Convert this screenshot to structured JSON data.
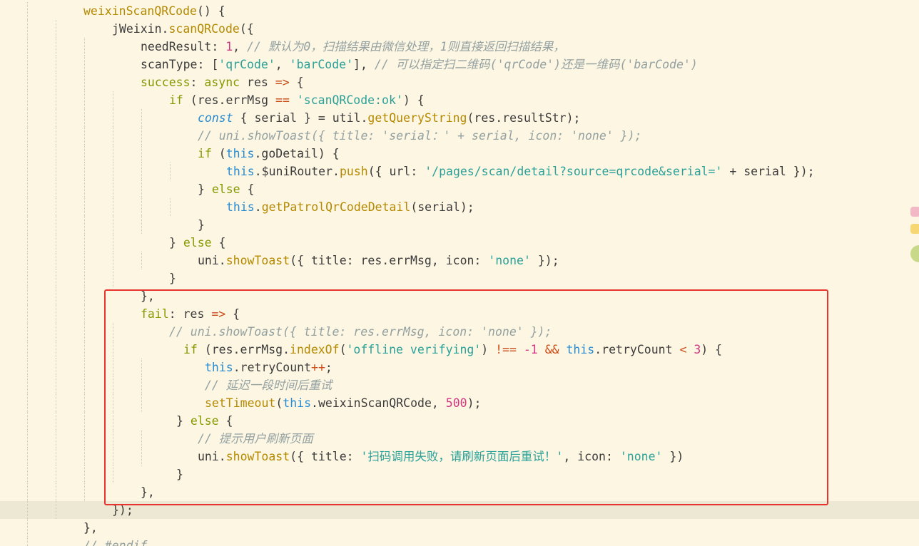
{
  "editor": {
    "language": "javascript",
    "current_line_index": 28,
    "lines": [
      {
        "indent": 0,
        "tokens": [
          [
            "fn",
            "weixinScanQRCode"
          ],
          [
            "plain",
            "() {"
          ]
        ]
      },
      {
        "indent": 1,
        "tokens": [
          [
            "plain",
            "jWeixin."
          ],
          [
            "fn",
            "scanQRCode"
          ],
          [
            "plain",
            "({"
          ]
        ]
      },
      {
        "indent": 2,
        "tokens": [
          [
            "plain",
            "needResult: "
          ],
          [
            "num",
            "1"
          ],
          [
            "plain",
            ", "
          ],
          [
            "cm",
            "// 默认为0，扫描结果由微信处理，1则直接返回扫描结果，"
          ]
        ]
      },
      {
        "indent": 2,
        "tokens": [
          [
            "plain",
            "scanType: ["
          ],
          [
            "str",
            "'qrCode'"
          ],
          [
            "plain",
            ", "
          ],
          [
            "str",
            "'barCode'"
          ],
          [
            "plain",
            "], "
          ],
          [
            "cm",
            "// 可以指定扫二维码('qrCode')还是一维码('barCode')"
          ]
        ]
      },
      {
        "indent": 2,
        "tokens": [
          [
            "prop",
            "success"
          ],
          [
            "plain",
            ": "
          ],
          [
            "kw",
            "async"
          ],
          [
            "plain",
            " res "
          ],
          [
            "op",
            "=>"
          ],
          [
            "plain",
            " {"
          ]
        ]
      },
      {
        "indent": 3,
        "tokens": [
          [
            "kw",
            "if"
          ],
          [
            "plain",
            " (res.errMsg "
          ],
          [
            "op",
            "=="
          ],
          [
            "plain",
            " "
          ],
          [
            "str",
            "'scanQRCode:ok'"
          ],
          [
            "plain",
            ") {"
          ]
        ]
      },
      {
        "indent": 4,
        "tokens": [
          [
            "const",
            "const"
          ],
          [
            "plain",
            " { serial } = util."
          ],
          [
            "fn",
            "getQueryString"
          ],
          [
            "plain",
            "(res.resultStr);"
          ]
        ]
      },
      {
        "indent": 4,
        "tokens": [
          [
            "cm",
            "// uni.showToast({ title: 'serial：' + serial, icon: 'none' });"
          ]
        ]
      },
      {
        "indent": 4,
        "tokens": [
          [
            "kw",
            "if"
          ],
          [
            "plain",
            " ("
          ],
          [
            "this",
            "this"
          ],
          [
            "plain",
            ".goDetail) {"
          ]
        ]
      },
      {
        "indent": 5,
        "tokens": [
          [
            "this",
            "this"
          ],
          [
            "plain",
            ".$uniRouter."
          ],
          [
            "fn",
            "push"
          ],
          [
            "plain",
            "({ url: "
          ],
          [
            "str",
            "'/pages/scan/detail?source=qrcode&serial='"
          ],
          [
            "plain",
            " + serial });"
          ]
        ]
      },
      {
        "indent": 4,
        "tokens": [
          [
            "plain",
            "} "
          ],
          [
            "kw",
            "else"
          ],
          [
            "plain",
            " {"
          ]
        ]
      },
      {
        "indent": 5,
        "tokens": [
          [
            "this",
            "this"
          ],
          [
            "plain",
            "."
          ],
          [
            "fn",
            "getPatrolQrCodeDetail"
          ],
          [
            "plain",
            "(serial);"
          ]
        ]
      },
      {
        "indent": 4,
        "tokens": [
          [
            "plain",
            "}"
          ]
        ]
      },
      {
        "indent": 3,
        "tokens": [
          [
            "plain",
            "} "
          ],
          [
            "kw",
            "else"
          ],
          [
            "plain",
            " {"
          ]
        ]
      },
      {
        "indent": 4,
        "tokens": [
          [
            "plain",
            "uni."
          ],
          [
            "fn",
            "showToast"
          ],
          [
            "plain",
            "({ title: res.errMsg, icon: "
          ],
          [
            "str",
            "'none'"
          ],
          [
            "plain",
            " });"
          ]
        ]
      },
      {
        "indent": 3,
        "tokens": [
          [
            "plain",
            "}"
          ]
        ]
      },
      {
        "indent": 2,
        "tokens": [
          [
            "plain",
            "},"
          ]
        ]
      },
      {
        "indent": 2,
        "tokens": [
          [
            "prop",
            "fail"
          ],
          [
            "plain",
            ": res "
          ],
          [
            "op",
            "=>"
          ],
          [
            "plain",
            " {"
          ]
        ]
      },
      {
        "indent": 3,
        "tokens": [
          [
            "cm",
            "// uni.showToast({ title: res.errMsg, icon: 'none' });"
          ]
        ]
      },
      {
        "indent": 3.5,
        "tokens": [
          [
            "kw",
            "if"
          ],
          [
            "plain",
            " (res.errMsg."
          ],
          [
            "fn",
            "indexOf"
          ],
          [
            "plain",
            "("
          ],
          [
            "str",
            "'offline verifying'"
          ],
          [
            "plain",
            ") "
          ],
          [
            "op",
            "!=="
          ],
          [
            "plain",
            " "
          ],
          [
            "num",
            "-1"
          ],
          [
            "plain",
            " "
          ],
          [
            "op",
            "&&"
          ],
          [
            "plain",
            " "
          ],
          [
            "this",
            "this"
          ],
          [
            "plain",
            ".retryCount "
          ],
          [
            "op",
            "<"
          ],
          [
            "plain",
            " "
          ],
          [
            "num",
            "3"
          ],
          [
            "plain",
            ") {"
          ]
        ]
      },
      {
        "indent": 4.25,
        "tokens": [
          [
            "this",
            "this"
          ],
          [
            "plain",
            ".retryCount"
          ],
          [
            "op",
            "++"
          ],
          [
            "plain",
            ";"
          ]
        ]
      },
      {
        "indent": 4.25,
        "tokens": [
          [
            "cm",
            "// 延迟一段时间后重试"
          ]
        ]
      },
      {
        "indent": 4.25,
        "tokens": [
          [
            "fn",
            "setTimeout"
          ],
          [
            "plain",
            "("
          ],
          [
            "this",
            "this"
          ],
          [
            "plain",
            ".weixinScanQRCode, "
          ],
          [
            "num",
            "500"
          ],
          [
            "plain",
            ");"
          ]
        ]
      },
      {
        "indent": 3.25,
        "tokens": [
          [
            "plain",
            "} "
          ],
          [
            "kw",
            "else"
          ],
          [
            "plain",
            " {"
          ]
        ]
      },
      {
        "indent": 4,
        "tokens": [
          [
            "cm",
            "// 提示用户刷新页面"
          ]
        ]
      },
      {
        "indent": 4,
        "tokens": [
          [
            "plain",
            "uni."
          ],
          [
            "fn",
            "showToast"
          ],
          [
            "plain",
            "({ title: "
          ],
          [
            "str",
            "'扫码调用失败，请刷新页面后重试！'"
          ],
          [
            "plain",
            ", icon: "
          ],
          [
            "str",
            "'none'"
          ],
          [
            "plain",
            " })"
          ]
        ]
      },
      {
        "indent": 3.25,
        "tokens": [
          [
            "plain",
            "}"
          ]
        ]
      },
      {
        "indent": 2,
        "tokens": [
          [
            "plain",
            "},"
          ]
        ]
      },
      {
        "indent": 1,
        "tokens": [
          [
            "plain",
            "});"
          ]
        ]
      },
      {
        "indent": 0,
        "tokens": [
          [
            "plain",
            "},"
          ]
        ]
      },
      {
        "indent": 0,
        "tokens": [
          [
            "cm",
            "// #endif"
          ]
        ]
      }
    ]
  },
  "annotation": {
    "color": "#e8332f"
  },
  "colors": {
    "background": "#fdf6e3",
    "current_line": "#ece8d3",
    "text": "#3c3c3c",
    "function": "#b58900",
    "string": "#2aa198",
    "number": "#d33682",
    "keyword": "#859900",
    "this": "#268bd2",
    "comment": "#93a1a1",
    "operator": "#cb4b16"
  }
}
